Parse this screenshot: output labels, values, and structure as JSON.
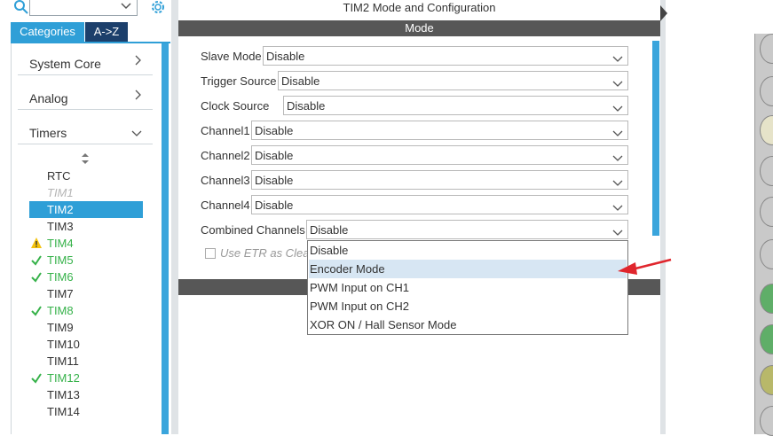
{
  "left_panel": {
    "tabs": {
      "categories": "Categories",
      "az": "A->Z"
    },
    "categories": [
      {
        "label": "System Core",
        "expanded": false
      },
      {
        "label": "Analog",
        "expanded": false
      },
      {
        "label": "Timers",
        "expanded": true
      }
    ],
    "timers": [
      {
        "label": "RTC",
        "state": "plain"
      },
      {
        "label": "TIM1",
        "state": "disabled"
      },
      {
        "label": "TIM2",
        "state": "selected"
      },
      {
        "label": "TIM3",
        "state": "plain"
      },
      {
        "label": "TIM4",
        "state": "warn"
      },
      {
        "label": "TIM5",
        "state": "ok"
      },
      {
        "label": "TIM6",
        "state": "ok"
      },
      {
        "label": "TIM7",
        "state": "plain"
      },
      {
        "label": "TIM8",
        "state": "ok"
      },
      {
        "label": "TIM9",
        "state": "plain"
      },
      {
        "label": "TIM10",
        "state": "plain"
      },
      {
        "label": "TIM11",
        "state": "plain"
      },
      {
        "label": "TIM12",
        "state": "ok"
      },
      {
        "label": "TIM13",
        "state": "plain"
      },
      {
        "label": "TIM14",
        "state": "plain"
      }
    ]
  },
  "center": {
    "title": "TIM2 Mode and Configuration",
    "mode_header": "Mode",
    "fields": [
      {
        "label": "Slave Mode",
        "value": "Disable"
      },
      {
        "label": "Trigger Source",
        "value": "Disable"
      },
      {
        "label": "Clock Source",
        "value": "Disable"
      },
      {
        "label": "Channel1",
        "value": "Disable"
      },
      {
        "label": "Channel2",
        "value": "Disable"
      },
      {
        "label": "Channel3",
        "value": "Disable"
      },
      {
        "label": "Channel4",
        "value": "Disable"
      },
      {
        "label": "Combined Channels",
        "value": "Disable"
      }
    ],
    "etr_label": "Use ETR as Clearing Source",
    "dropdown_options": [
      "Disable",
      "Encoder Mode",
      "PWM Input on CH1",
      "PWM Input on CH2",
      "XOR ON / Hall Sensor Mode"
    ],
    "hovered_option": "Encoder Mode"
  },
  "colors": {
    "accent": "#2f9fd7",
    "tab_dark": "#1c3f6b",
    "header_bar": "#575757",
    "ok_green": "#36b24a",
    "warn_yellow": "#f4c20d",
    "annotation_red": "#e0262d"
  }
}
